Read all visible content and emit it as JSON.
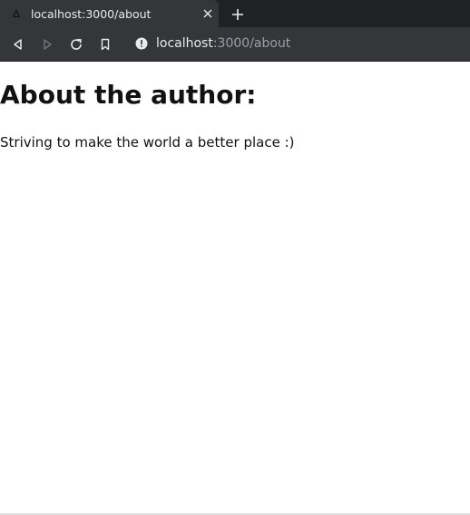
{
  "browser": {
    "tab": {
      "title": "localhost:3000/about",
      "favicon_icon": "page-favicon-icon",
      "close_icon": "close-icon"
    },
    "new_tab_icon": "plus-icon",
    "toolbar": {
      "back_icon": "back-arrow-icon",
      "forward_icon": "forward-arrow-icon",
      "reload_icon": "reload-icon",
      "bookmark_icon": "bookmark-icon"
    },
    "address_bar": {
      "info_icon": "info-icon",
      "host": "localhost",
      "path": ":3000/about"
    },
    "colors": {
      "chrome_dark": "#202124",
      "chrome_tab": "#35363a",
      "text_light": "#e8eaed",
      "text_muted": "#9aa0a6"
    }
  },
  "page": {
    "heading": "About the author:",
    "body": "Striving to make the world a better place :)"
  }
}
